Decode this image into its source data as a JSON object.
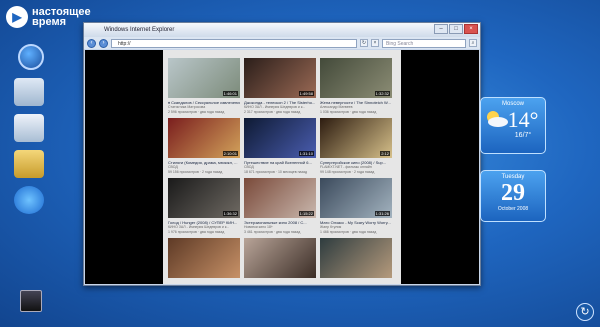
{
  "brand": {
    "line1": "настоящее",
    "line2": "время",
    "mark": "▶"
  },
  "window": {
    "title": "Windows Internet Explorer",
    "address": "http://",
    "search_placeholder": "Bing Search"
  },
  "videos": [
    {
      "title": "♦ Скандалов / Сексуальное извлечение...",
      "meta": "Статистика Матросова",
      "views": "2 596 просмотров · два года назад",
      "duration": "1:46:01",
      "colors": [
        "#b9c6c9",
        "#7c8b7a"
      ]
    },
    {
      "title": "Джоконда - телескоп 2 / The Sisterho...",
      "meta": "КИНО ЗАЛ - Империя Шедевров и к...",
      "views": "2 317 просмотров · два года назад",
      "duration": "1:49:58",
      "colors": [
        "#2b1e1a",
        "#9b6a55"
      ]
    },
    {
      "title": "Жена неверности / The Sinnoteich W...",
      "meta": "Александр Матвеев",
      "views": "1 036 просмотров · два года назад",
      "duration": "1:32:32",
      "colors": [
        "#434a3a",
        "#8c8d75"
      ]
    },
    {
      "title": "Стиляги (Комедия, драма, мюзикл, ...",
      "meta": "СВОД",
      "views": "59 156 просмотров · 2 года назад",
      "duration": "2:10:01",
      "colors": [
        "#7a1e1e",
        "#d3a35b"
      ]
    },
    {
      "title": "Путешествие на край Вселенной 6...",
      "meta": "СВОД",
      "views": "18 671 просмотров · 10 месяцев назад",
      "duration": "1:31:10",
      "colors": [
        "#0e1a33",
        "#4a5db0"
      ]
    },
    {
      "title": "Супергеройское кино (2008) / Sup...",
      "meta": "FLAMIXT.NET - фильмы онлайн",
      "views": "99 148 просмотров · 2 года назад",
      "duration": "2:12",
      "colors": [
        "#2d1c10",
        "#d6c08a"
      ]
    },
    {
      "title": "Голод / Hunger (2008) / СУПЕР КИН...",
      "meta": "КИНО ЗАЛ - Империя Шедевров и к...",
      "views": "1 976 просмотров · два года назад",
      "duration": "1:36:32",
      "colors": [
        "#1a1a1a",
        "#6f6a63"
      ]
    },
    {
      "title": "Эстерзиональные кино 2008 / С...",
      "meta": "Новинки кино 18+",
      "views": "3 461 просмотров · два года назад",
      "duration": "1:15:22",
      "colors": [
        "#7a4a3a",
        "#c9b7ad"
      ]
    },
    {
      "title": "Мато Олзасс - My Scary Worry Worry...",
      "meta": "Жанр Ктулия",
      "views": "1 466 просмотров · два года назад",
      "duration": "1:31:26",
      "colors": [
        "#3b4a5c",
        "#a3b3bf"
      ]
    },
    {
      "title": "",
      "meta": "",
      "views": "",
      "duration": "",
      "colors": [
        "#5e3a26",
        "#c79167"
      ]
    },
    {
      "title": "",
      "meta": "",
      "views": "",
      "duration": "",
      "colors": [
        "#b8a498",
        "#3b2d26"
      ]
    },
    {
      "title": "",
      "meta": "",
      "views": "",
      "duration": "",
      "colors": [
        "#2e3c3f",
        "#b59a7c"
      ]
    }
  ],
  "weather": {
    "city": "Moscow",
    "temp": "14°",
    "range": "16/7°"
  },
  "calendar": {
    "day_name": "Tuesday",
    "day": "29",
    "month_year": "October 2008"
  },
  "icons": {
    "start": "start-orb-icon",
    "corner": "refresh-icon"
  }
}
